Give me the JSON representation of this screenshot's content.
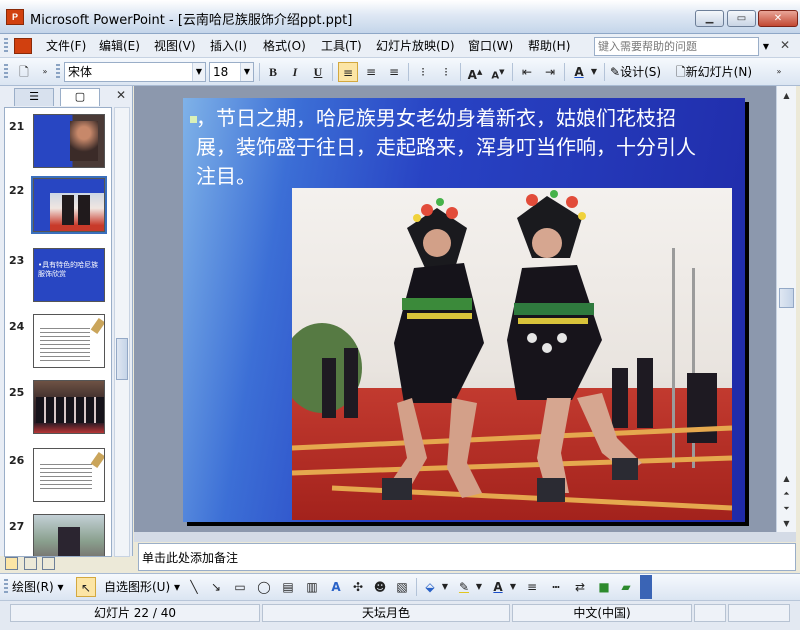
{
  "window": {
    "title": "Microsoft PowerPoint - [云南哈尼族服饰介绍ppt.ppt]",
    "app_icon_text": "P"
  },
  "menu": {
    "items": [
      "文件(F)",
      "编辑(E)",
      "视图(V)",
      "插入(I)",
      "格式(O)",
      "工具(T)",
      "幻灯片放映(D)",
      "窗口(W)",
      "帮助(H)"
    ],
    "help_placeholder": "键入需要帮助的问题"
  },
  "toolbar": {
    "font_name": "宋体",
    "font_size": "18",
    "bold": "B",
    "italic": "I",
    "underline": "U",
    "design_label": "设计(S)",
    "new_slide_label": "新幻灯片(N)"
  },
  "thumbnails": [
    {
      "num": "21",
      "caption": ""
    },
    {
      "num": "22",
      "caption": ""
    },
    {
      "num": "23",
      "caption": "•具有特色的哈尼族服饰欣赏"
    },
    {
      "num": "24",
      "caption": ""
    },
    {
      "num": "25",
      "caption": ""
    },
    {
      "num": "26",
      "caption": ""
    },
    {
      "num": "27",
      "caption": ""
    }
  ],
  "slide": {
    "text": "，节日之期，哈尼族男女老幼身着新衣，姑娘们花枝招展，装饰盛于往日，走起路来，浑身叮当作响，十分引人注目。"
  },
  "notes": {
    "placeholder": "单击此处添加备注"
  },
  "drawing": {
    "draw_label": "绘图(R)",
    "autoshape_label": "自选图形(U)"
  },
  "status": {
    "slide_pos": "幻灯片 22 / 40",
    "design": "天坛月色",
    "language": "中文(中国)"
  }
}
